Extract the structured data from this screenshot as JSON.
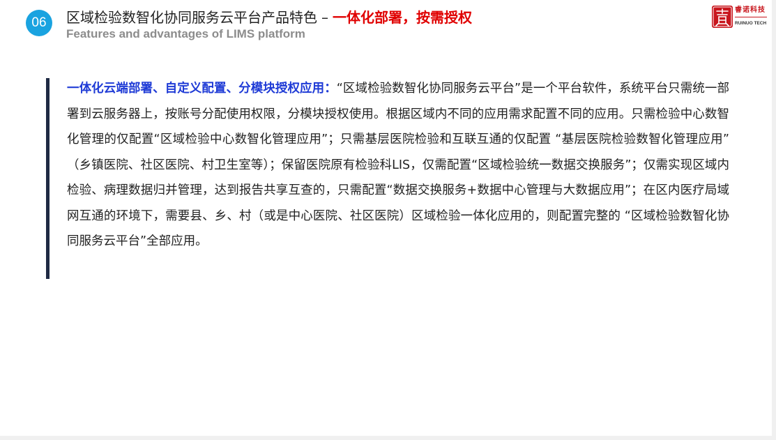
{
  "header": {
    "section_number": "06",
    "title_main": "区域检验数智化协同服务云平台产品特色",
    "title_separator": "–",
    "title_highlight": "一体化部署，按需授权",
    "subtitle": "Features and advantages of LIMS platform"
  },
  "logo": {
    "seal_text": "睿",
    "cn_name": "睿诺科技",
    "en_name": "RUINUO TECH"
  },
  "content": {
    "lead": "一体化云端部署、自定义配置、分模块授权应用：",
    "body": "“区域检验数智化协同服务云平台”是一个平台软件，系统平台只需统一部署到云服务器上，按账号分配使用权限，分模块授权使用。根据区域内不同的应用需求配置不同的应用。只需检验中心数智化管理的仅配置“区域检验中心数智化管理应用”；只需基层医院检验和互联互通的仅配置 “基层医院检验数智化管理应用” （乡镇医院、社区医院、村卫生室等）；保留医院原有检验科LIS，仅需配置“区域检验统一数据交换服务”；仅需实现区域内检验、病理数据归并管理，达到报告共享互查的，只需配置“数据交换服务+数据中心管理与大数据应用”；在区内医疗局域网互通的环境下，需要县、乡、村（或是中心医院、社区医院）区域检验一体化应用的，则配置完整的 “区域检验数智化协同服务云平台”全部应用。"
  },
  "colors": {
    "badge": "#1aa3e0",
    "title_highlight": "#e00000",
    "lead_text": "#1f3bd6",
    "accent_bar": "#1f2a44",
    "logo_red": "#c8161d"
  }
}
